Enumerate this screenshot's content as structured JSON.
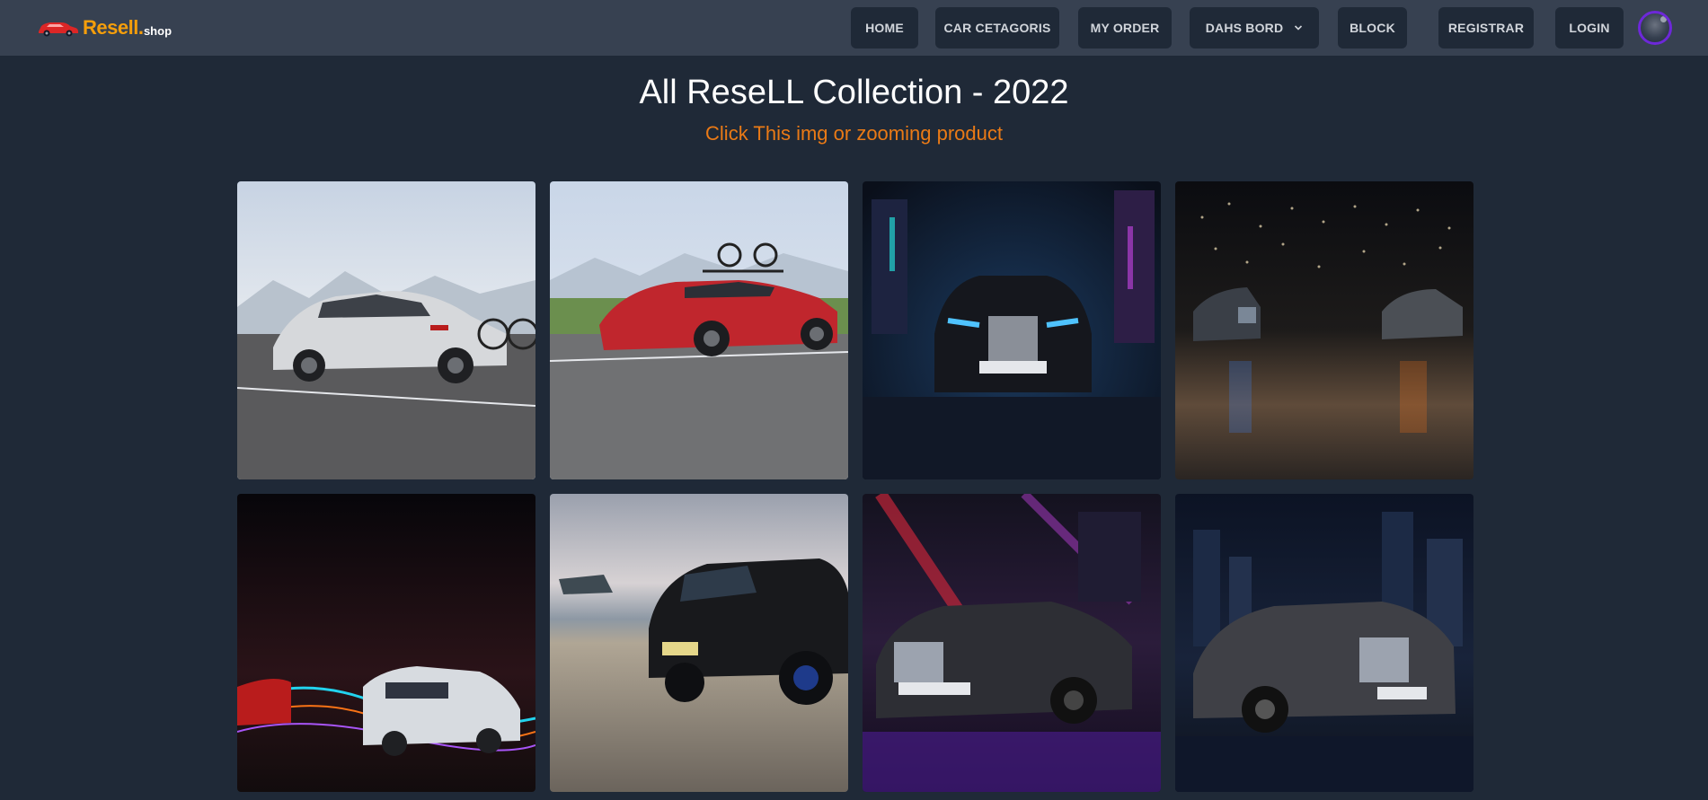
{
  "header": {
    "brand": {
      "name": "Resell",
      "dot": ".",
      "suffix": "shop"
    },
    "nav": [
      {
        "id": "home",
        "label": "HOME"
      },
      {
        "id": "car-categories",
        "label": "CAR CETAGORIS"
      },
      {
        "id": "my-order",
        "label": "MY ORDER"
      },
      {
        "id": "dashboard",
        "label": "DAHS BORD"
      },
      {
        "id": "block",
        "label": "BLOCK"
      },
      {
        "id": "register",
        "label": "REGISTRAR"
      },
      {
        "id": "login",
        "label": "LOGIN"
      }
    ],
    "dashboard_icon": "chevron-down-icon"
  },
  "main": {
    "title": "All ReseLL Collection - 2022",
    "subtitle": "Click This img or zooming product"
  },
  "colors": {
    "page_bg": "#1f2937",
    "navbar_bg": "#374151",
    "brand": "#f59e0b",
    "subtitle": "#ea7a16",
    "avatar_ring": "#6d28d9"
  }
}
